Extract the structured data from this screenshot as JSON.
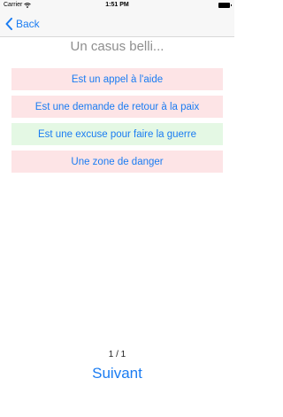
{
  "status_bar": {
    "carrier": "Carrier",
    "time": "1:51 PM"
  },
  "nav": {
    "back_label": "Back"
  },
  "question": "Un casus belli...",
  "answers": [
    {
      "label": "Est un appel à l'aide",
      "state": "wrong"
    },
    {
      "label": "Est une demande de retour à la paix",
      "state": "wrong"
    },
    {
      "label": "Est une excuse pour faire la guerre",
      "state": "correct"
    },
    {
      "label": "Une zone de danger",
      "state": "wrong"
    }
  ],
  "counter": "1 / 1",
  "next_label": "Suivant",
  "colors": {
    "accent": "#1a7cf2",
    "wrong_bg": "#fde4e6",
    "correct_bg": "#e4f8e4",
    "question_text": "#8e8e8e"
  }
}
